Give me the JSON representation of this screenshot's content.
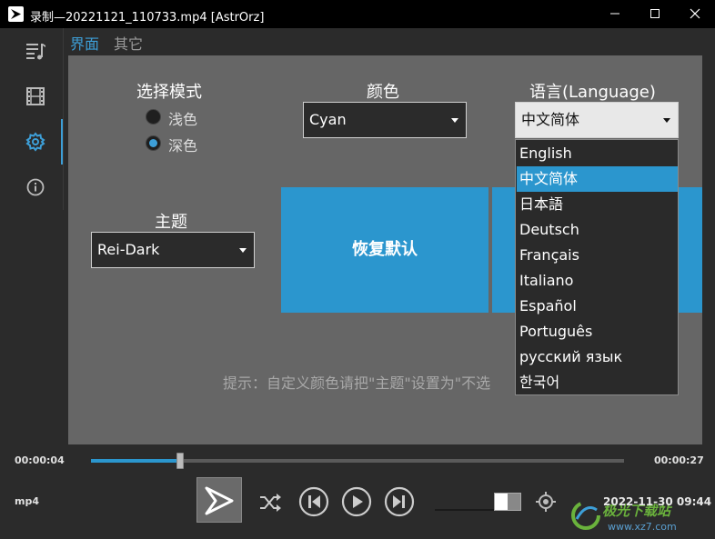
{
  "window": {
    "title": "录制—20221121_110733.mp4 [AstrOrz]"
  },
  "sidebar": {
    "items": [
      {
        "icon": "playlist-icon"
      },
      {
        "icon": "film-icon"
      },
      {
        "icon": "gear-icon",
        "active": true
      },
      {
        "icon": "info-icon"
      }
    ]
  },
  "tabs": [
    {
      "label": "界面",
      "active": true
    },
    {
      "label": "其它",
      "active": false
    }
  ],
  "settings": {
    "mode": {
      "heading": "选择模式",
      "options": [
        {
          "label": "浅色",
          "selected": false
        },
        {
          "label": "深色",
          "selected": true
        }
      ]
    },
    "color": {
      "heading": "颜色",
      "value": "Cyan"
    },
    "language": {
      "heading": "语言(Language)",
      "value": "中文简体",
      "options": [
        "English",
        "中文简体",
        "日本語",
        "Deutsch",
        "Français",
        "Italiano",
        "Español",
        "Português",
        "русский язык",
        "한국어"
      ],
      "selected_index": 1
    },
    "theme": {
      "heading": "主题",
      "value": "Rei-Dark"
    },
    "reset_button": "恢复默认",
    "hint": "提示：自定义颜色请把\"主题\"设置为\"不选"
  },
  "player": {
    "current_time": "00:00:04",
    "total_time": "00:00:27",
    "progress": 0.168,
    "format": "mp4",
    "datetime": "2022-11-30 09:44",
    "volume": 0.5
  },
  "watermark": {
    "text": "极光下载站",
    "url": "www.xz7.com"
  },
  "colors": {
    "accent": "#2b96ce",
    "panel": "#666666",
    "background": "#2b2b2b"
  }
}
